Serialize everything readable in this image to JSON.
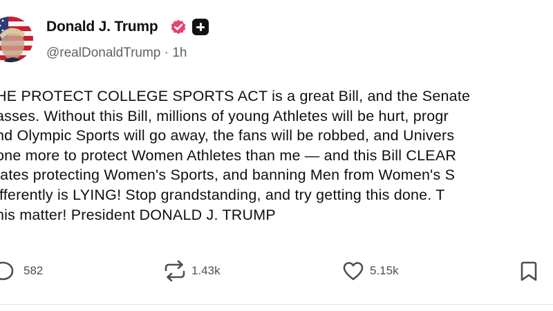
{
  "post": {
    "author": {
      "display_name": "Donald J. Trump",
      "handle": "@realDonaldTrump",
      "separator": " · ",
      "time": "1h",
      "verified_color": "#e8426e"
    },
    "body_lines": [
      "HE PROTECT COLLEGE SPORTS ACT is a great Bill, and the Senate",
      "asses. Without this Bill, millions of young Athletes will be hurt, progr",
      "nd Olympic Sports will go away, the fans will be robbed, and Univers",
      "one more to protect Women Athletes than me — and this Bill CLEAR",
      "tates protecting Women's Sports, and banning Men from Women's S",
      "ifferently is LYING! Stop grandstanding, and try getting this done. T",
      "his matter! President DONALD J. TRUMP"
    ],
    "actions": {
      "replies": "582",
      "retruths": "1.43k",
      "likes": "5.15k"
    }
  }
}
